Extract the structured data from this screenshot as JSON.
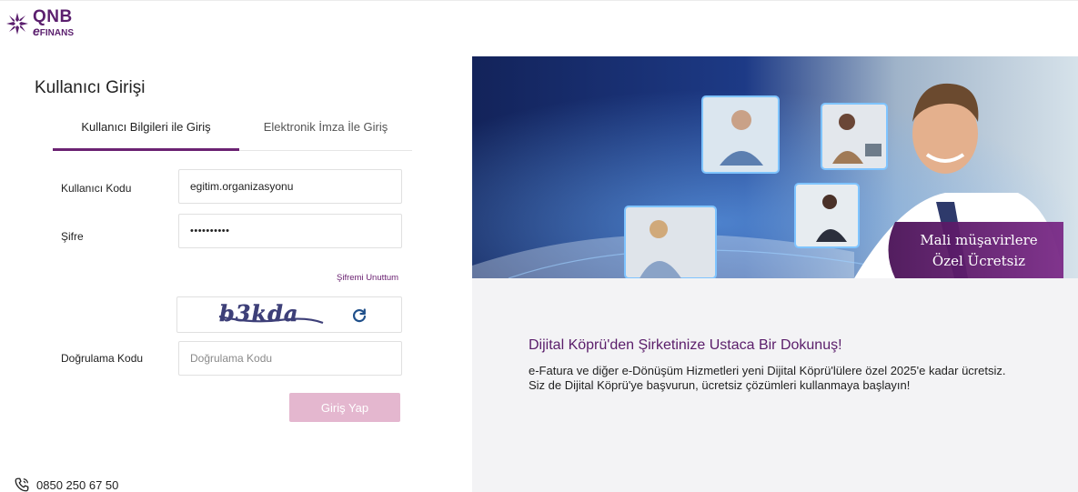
{
  "brand": {
    "logo_line1": "QNB",
    "logo_line2_e": "e",
    "logo_line2_rest": "FINANS"
  },
  "login": {
    "title": "Kullanıcı Girişi",
    "tabs": [
      {
        "label": "Kullanıcı Bilgileri ile Giriş",
        "active": true
      },
      {
        "label": "Elektronik İmza İle Giriş",
        "active": false
      }
    ],
    "username_label": "Kullanıcı Kodu",
    "username_value": "egitim.organizasyonu",
    "password_label": "Şifre",
    "password_value": "••••••••••",
    "forgot_password": "Şifremi Unuttum",
    "captcha_text": "b3kda",
    "verification_label": "Doğrulama Kodu",
    "verification_placeholder": "Doğrulama Kodu",
    "submit_label": "Giriş Yap"
  },
  "contact": {
    "phone": "0850 250 67 50"
  },
  "banner": {
    "caption_line1": "Mali müşavirlere",
    "caption_line2": "Özel Ücretsiz"
  },
  "promo": {
    "title": "Dijital Köprü'den Şirketinize Ustaca Bir Dokunuş!",
    "line1": "e-Fatura ve diğer e-Dönüşüm Hizmetleri yeni Dijital Köprü'lülere özel 2025'e kadar ücretsiz.",
    "line2": "Siz de Dijital Köprü'ye başvurun, ücretsiz çözümleri kullanmaya başlayın!"
  },
  "colors": {
    "brand_purple": "#6b2272",
    "button_disabled": "#e4b7cf",
    "banner_dark": "#1c2f6e"
  },
  "icons": [
    "qnb-logo-icon",
    "refresh-icon",
    "phone-icon"
  ]
}
